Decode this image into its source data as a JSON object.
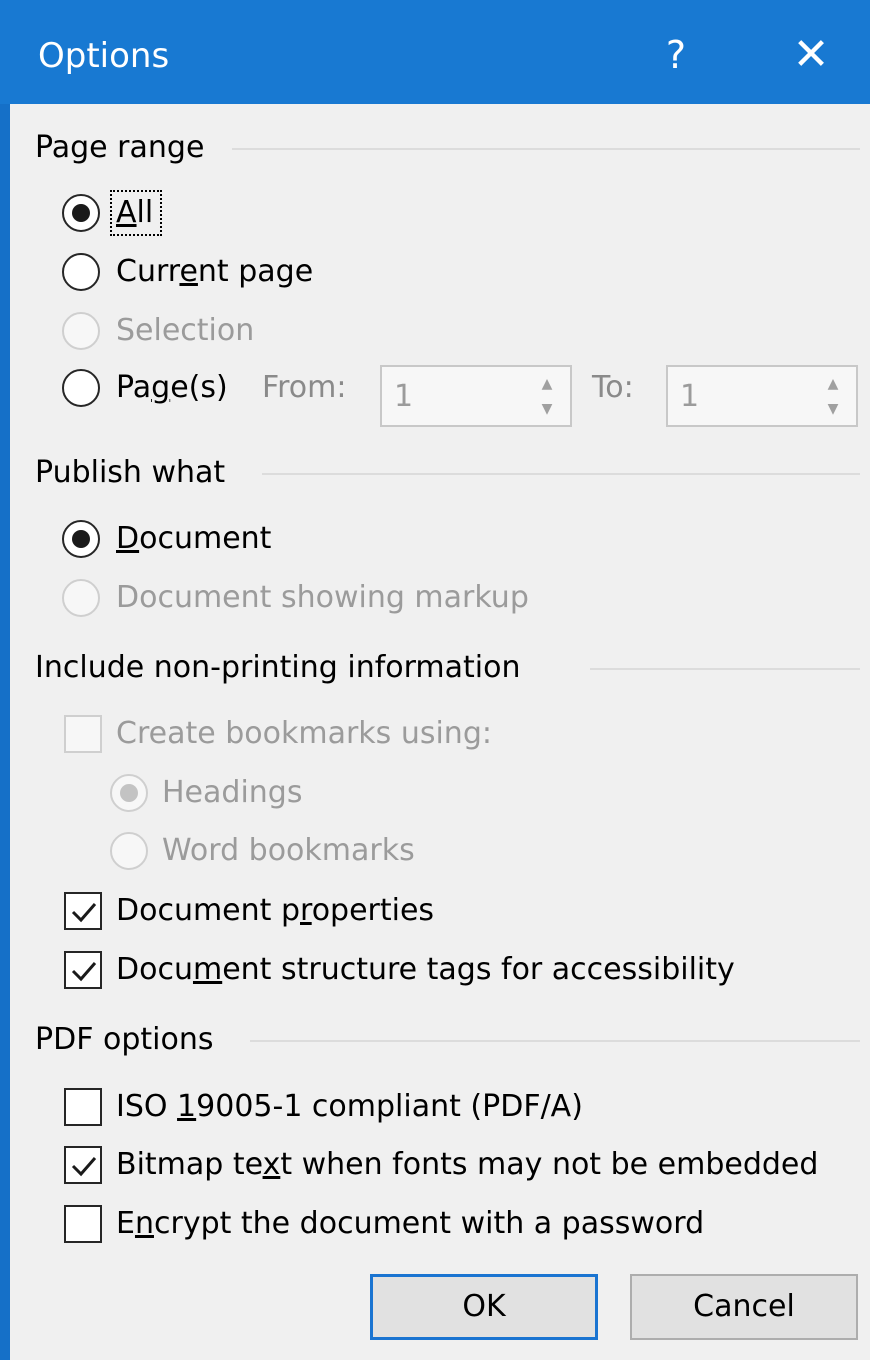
{
  "window": {
    "title": "Options",
    "help_label": "?",
    "close_label": "✕"
  },
  "page_range": {
    "header": "Page range",
    "all_pre": "",
    "all_u": "A",
    "all_post": "ll",
    "current_pre": "Curr",
    "current_u": "e",
    "current_post": "nt page",
    "selection": "Selection",
    "pages_pre": "Pa",
    "pages_u": "g",
    "pages_post": "e(s)",
    "from_label": "From:",
    "from_value": "1",
    "to_label": "To:",
    "to_value": "1"
  },
  "publish_what": {
    "header": "Publish what",
    "document_pre": "",
    "document_u": "D",
    "document_post": "ocument",
    "document_markup": "Document showing markup"
  },
  "non_printing": {
    "header": "Include non-printing information",
    "create_bookmarks": "Create bookmarks using:",
    "headings": "Headings",
    "word_bookmarks": "Word bookmarks",
    "doc_props_pre": "Document p",
    "doc_props_u": "r",
    "doc_props_post": "operties",
    "struct_pre": "Docu",
    "struct_u": "m",
    "struct_post": "ent structure tags for accessibility"
  },
  "pdf_options": {
    "header": "PDF options",
    "iso_pre": "ISO ",
    "iso_u": "1",
    "iso_post": "9005-1 compliant (PDF/A)",
    "bitmap_pre": "Bitmap te",
    "bitmap_u": "x",
    "bitmap_post": "t when fonts may not be embedded",
    "encrypt_pre": "E",
    "encrypt_u": "n",
    "encrypt_post": "crypt the document with a password"
  },
  "buttons": {
    "ok": "OK",
    "cancel": "Cancel"
  },
  "colors": {
    "titlebar": "#1879d2",
    "accent_border": "#1a74d1",
    "dialog_bg": "#f0f0f0"
  }
}
